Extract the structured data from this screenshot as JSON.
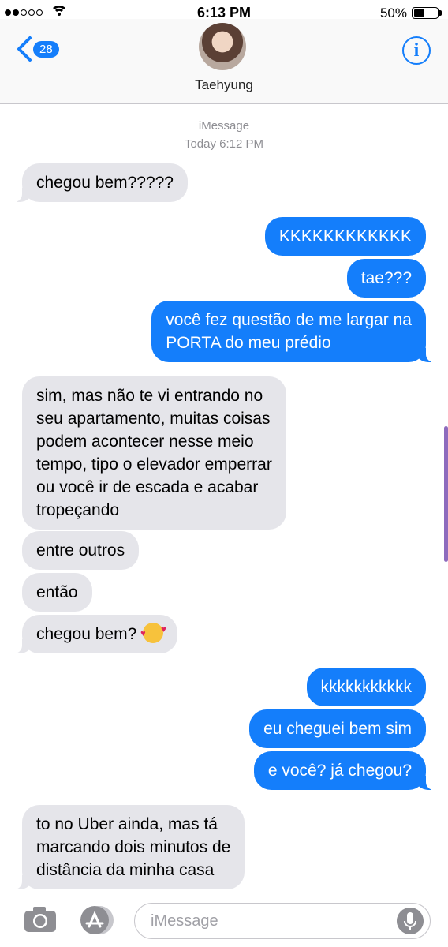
{
  "status_bar": {
    "signal_dots_filled": 2,
    "signal_dots_total": 5,
    "time": "6:13 PM",
    "battery_percent": "50%"
  },
  "header": {
    "back_badge": "28",
    "contact_name": "Taehyung",
    "info_icon": "info-icon"
  },
  "meta": {
    "service": "iMessage",
    "timestamp": "Today 6:12 PM"
  },
  "messages": [
    {
      "from": "received",
      "lines": [
        "chegou bem?????"
      ]
    },
    {
      "from": "sent",
      "lines": [
        "KKKKKKKKKKKK"
      ]
    },
    {
      "from": "sent",
      "lines": [
        "tae???"
      ]
    },
    {
      "from": "sent",
      "lines": [
        "você fez questão de me largar na",
        "PORTA do meu prédio"
      ]
    },
    {
      "from": "received",
      "lines": [
        "sim, mas não te vi entrando no",
        "seu apartamento, muitas coisas",
        "podem acontecer nesse meio",
        "tempo, tipo o elevador emperrar",
        "ou você ir de escada e acabar",
        "tropeçando"
      ]
    },
    {
      "from": "received",
      "lines": [
        "entre outros"
      ]
    },
    {
      "from": "received",
      "lines": [
        "então"
      ]
    },
    {
      "from": "received",
      "lines": [
        "chegou bem? "
      ],
      "emoji": "smiling-face-with-hearts-icon"
    },
    {
      "from": "sent",
      "lines": [
        "kkkkkkkkkkk"
      ]
    },
    {
      "from": "sent",
      "lines": [
        "eu cheguei bem sim"
      ]
    },
    {
      "from": "sent",
      "lines": [
        "e você? já chegou?"
      ]
    },
    {
      "from": "received",
      "lines": [
        "to no Uber ainda, mas tá",
        "marcando dois minutos de",
        "distância da minha casa"
      ]
    }
  ],
  "input_bar": {
    "placeholder": "iMessage",
    "icons": [
      "camera-icon",
      "app-store-icon",
      "microphone-icon"
    ]
  },
  "colors": {
    "sent_bubble": "#147efb",
    "received_bubble": "#e5e5ea",
    "accent": "#147efb",
    "meta_text": "#8e8e93"
  }
}
